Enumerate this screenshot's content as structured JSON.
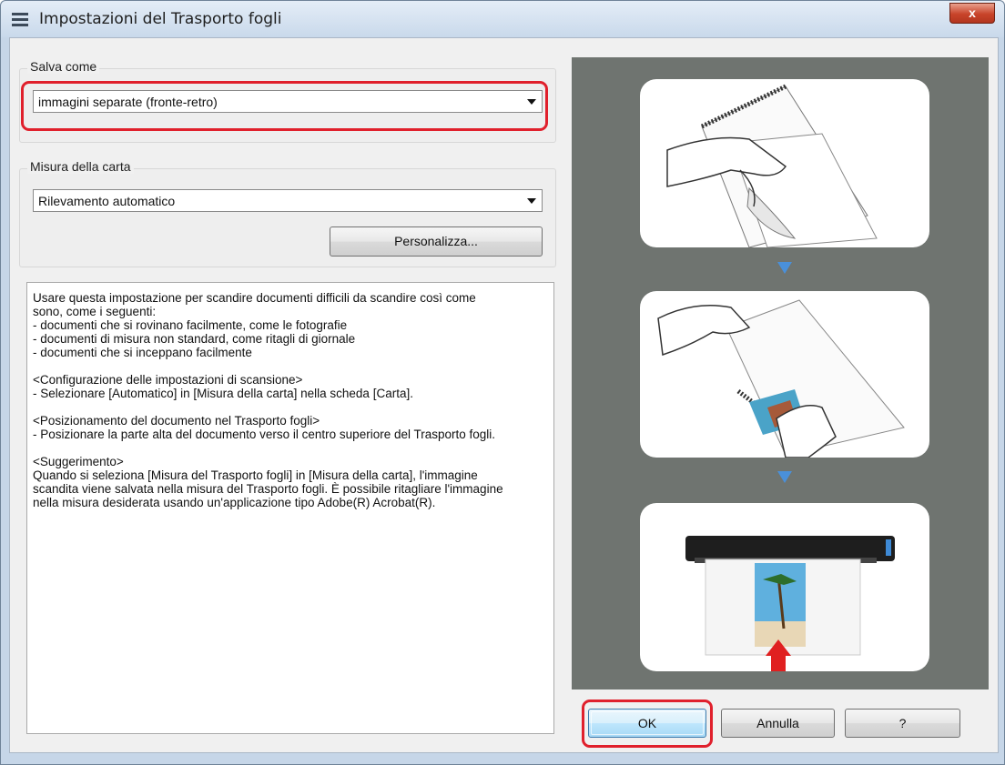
{
  "window": {
    "title": "Impostazioni del Trasporto fogli",
    "close_label": "x"
  },
  "save_as": {
    "group_label": "Salva come",
    "selected": "immagini separate (fronte-retro)"
  },
  "paper_size": {
    "group_label": "Misura della carta",
    "selected": "Rilevamento automatico",
    "customize_label": "Personalizza..."
  },
  "description": {
    "lines": [
      "Usare questa impostazione per scandire documenti difficili da scandire così come",
      "sono, come i seguenti:",
      "- documenti che si rovinano facilmente, come le fotografie",
      "- documenti di misura non standard, come ritagli di giornale",
      "- documenti che si inceppano facilmente",
      "",
      "<Configurazione delle impostazioni di scansione>",
      "- Selezionare [Automatico] in [Misura della carta] nella scheda [Carta].",
      "",
      "<Posizionamento del documento nel Trasporto fogli>",
      "- Posizionare la parte alta del documento verso il centro superiore del Trasporto fogli.",
      "",
      "<Suggerimento>",
      "Quando si seleziona [Misura del Trasporto fogli] in [Misura della carta], l'immagine",
      "scandita viene salvata nella misura del Trasporto fogli. È possibile ritagliare l'immagine",
      "nella misura desiderata usando un'applicazione tipo Adobe(R) Acrobat(R)."
    ]
  },
  "buttons": {
    "ok": "OK",
    "cancel": "Annulla",
    "help": "?"
  },
  "colors": {
    "highlight": "#e0202c",
    "arrow": "#4a90d9",
    "illustration_bg": "#6f7470"
  }
}
